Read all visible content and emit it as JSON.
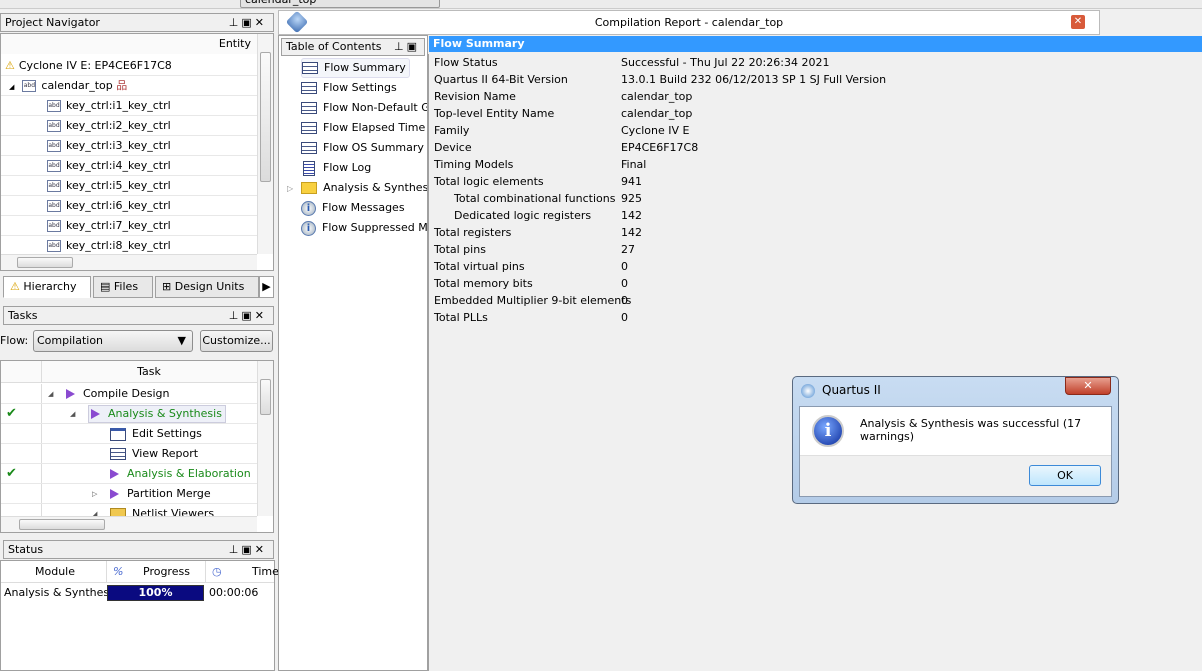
{
  "toolbar": {
    "project_field": "calendar_top"
  },
  "navigator": {
    "title": "Project Navigator",
    "column": "Entity",
    "device": "Cyclone IV E: EP4CE6F17C8",
    "top": "calendar_top",
    "items": [
      "key_ctrl:i1_key_ctrl",
      "key_ctrl:i2_key_ctrl",
      "key_ctrl:i3_key_ctrl",
      "key_ctrl:i4_key_ctrl",
      "key_ctrl:i5_key_ctrl",
      "key_ctrl:i6_key_ctrl",
      "key_ctrl:i7_key_ctrl",
      "key_ctrl:i8_key_ctrl"
    ],
    "tabs": [
      "Hierarchy",
      "Files",
      "Design Units"
    ],
    "abd": "abd"
  },
  "tasks": {
    "title": "Tasks",
    "flow_label": "Flow:",
    "flow_value": "Compilation",
    "customize": "Customize...",
    "column": "Task",
    "rows": [
      {
        "label": "Compile Design",
        "done": false,
        "indent": 0,
        "green": false,
        "icon": "play",
        "exp": "open"
      },
      {
        "label": "Analysis & Synthesis",
        "done": true,
        "indent": 1,
        "green": true,
        "icon": "play",
        "exp": "open"
      },
      {
        "label": "Edit Settings",
        "done": false,
        "indent": 2,
        "green": false,
        "icon": "settings",
        "exp": ""
      },
      {
        "label": "View Report",
        "done": false,
        "indent": 2,
        "green": false,
        "icon": "table",
        "exp": ""
      },
      {
        "label": "Analysis & Elaboration",
        "done": true,
        "indent": 2,
        "green": true,
        "icon": "play",
        "exp": ""
      },
      {
        "label": "Partition Merge",
        "done": false,
        "indent": 2,
        "green": false,
        "icon": "play",
        "exp": "closed"
      },
      {
        "label": "Netlist Viewers",
        "done": false,
        "indent": 2,
        "green": false,
        "icon": "folder",
        "exp": "open"
      }
    ]
  },
  "status": {
    "title": "Status",
    "cols": [
      "Module",
      "%",
      "Progress",
      "Time"
    ],
    "module": "Analysis & Synthesis",
    "progress_pct": 100,
    "progress_text": "100%",
    "time": "00:00:06"
  },
  "report": {
    "title": "Compilation Report - calendar_top",
    "toc_title": "Table of Contents",
    "toc": [
      {
        "label": "Flow Summary",
        "icon": "table"
      },
      {
        "label": "Flow Settings",
        "icon": "table"
      },
      {
        "label": "Flow Non-Default Global Settings",
        "icon": "table"
      },
      {
        "label": "Flow Elapsed Time",
        "icon": "table"
      },
      {
        "label": "Flow OS Summary",
        "icon": "table"
      },
      {
        "label": "Flow Log",
        "icon": "doc"
      },
      {
        "label": "Analysis & Synthesis",
        "icon": "folder"
      },
      {
        "label": "Flow Messages",
        "icon": "info"
      },
      {
        "label": "Flow Suppressed Messages",
        "icon": "info"
      }
    ],
    "summary_title": "Flow Summary",
    "summary": [
      {
        "k": "Flow Status",
        "v": "Successful - Thu Jul 22 20:26:34 2021",
        "i": 0
      },
      {
        "k": "Quartus II 64-Bit Version",
        "v": "13.0.1 Build 232 06/12/2013 SP 1 SJ Full Version",
        "i": 0
      },
      {
        "k": "Revision Name",
        "v": "calendar_top",
        "i": 0
      },
      {
        "k": "Top-level Entity Name",
        "v": "calendar_top",
        "i": 0
      },
      {
        "k": "Family",
        "v": "Cyclone IV E",
        "i": 0
      },
      {
        "k": "Device",
        "v": "EP4CE6F17C8",
        "i": 0
      },
      {
        "k": "Timing Models",
        "v": "Final",
        "i": 0
      },
      {
        "k": "Total logic elements",
        "v": "941",
        "i": 0
      },
      {
        "k": "Total combinational functions",
        "v": "925",
        "i": 1
      },
      {
        "k": "Dedicated logic registers",
        "v": "142",
        "i": 1
      },
      {
        "k": "Total registers",
        "v": "142",
        "i": 0
      },
      {
        "k": "Total pins",
        "v": "27",
        "i": 0
      },
      {
        "k": "Total virtual pins",
        "v": "0",
        "i": 0
      },
      {
        "k": "Total memory bits",
        "v": "0",
        "i": 0
      },
      {
        "k": "Embedded Multiplier 9-bit elements",
        "v": "0",
        "i": 0
      },
      {
        "k": "Total PLLs",
        "v": "0",
        "i": 0
      }
    ]
  },
  "dialog": {
    "title": "Quartus II",
    "message": "Analysis & Synthesis was successful (17 warnings)",
    "ok": "OK",
    "close": "✕"
  },
  "colors": {
    "accent": "#3399ff",
    "progress": "#0a0a80",
    "success": "#1a8a1a"
  }
}
